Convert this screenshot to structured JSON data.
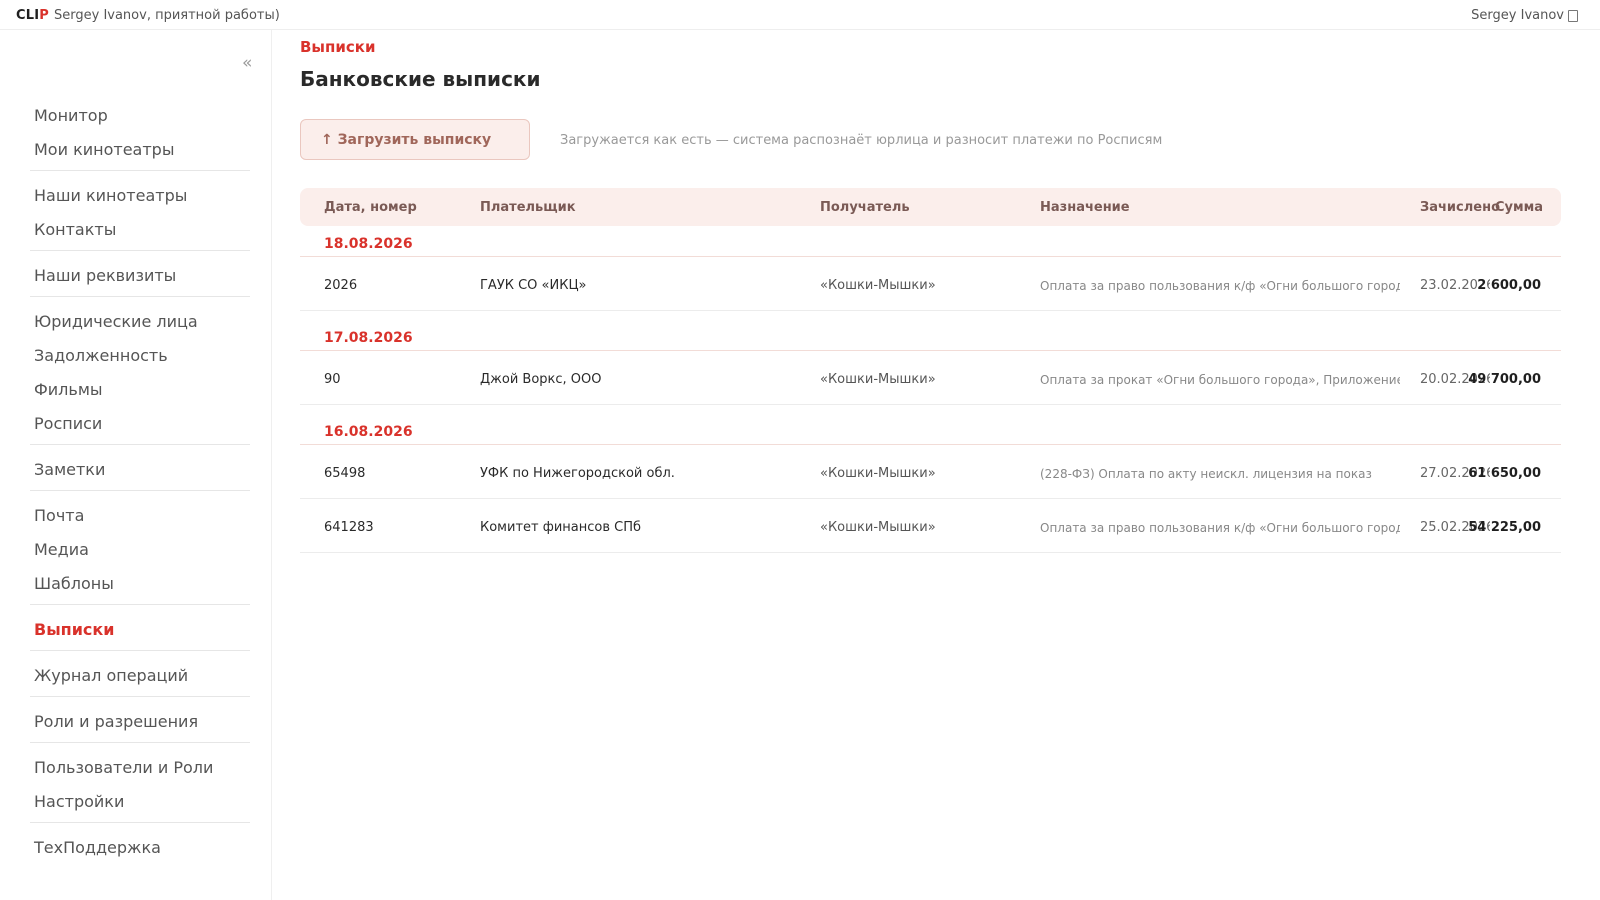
{
  "header": {
    "brand_main": "CLI",
    "brand_accent": "P",
    "greeting": "Sergey Ivanov, приятной работы)",
    "user_name": "Sergey Ivanov"
  },
  "sidebar": {
    "collapse_label": "«",
    "items": [
      {
        "label": "Монитор"
      },
      {
        "label": "Мои кинотеатры"
      },
      {
        "label": "Наши кинотеатры"
      },
      {
        "label": "Контакты"
      },
      {
        "label": "Наши реквизиты"
      },
      {
        "label": "Юридические лица"
      },
      {
        "label": "Задолженность"
      },
      {
        "label": "Фильмы"
      },
      {
        "label": "Росписи"
      },
      {
        "label": "Заметки"
      },
      {
        "label": "Почта"
      },
      {
        "label": "Медиа"
      },
      {
        "label": "Шаблоны"
      },
      {
        "label": "Выписки",
        "active": true
      },
      {
        "label": "Журнал операций"
      },
      {
        "label": "Роли и разрешения"
      },
      {
        "label": "Пользователи и Роли"
      },
      {
        "label": "Настройки"
      },
      {
        "label": "ТехПоддержка"
      }
    ]
  },
  "main": {
    "breadcrumb": "Выписки",
    "title": "Банковские выписки",
    "upload_label": "↑ Загрузить выписку",
    "upload_hint": "Загружается как есть — система распознаёт юрлица и разносит платежи по Росписям",
    "columns": [
      "Дата, номер",
      "Плательщик",
      "Получатель",
      "Назначение",
      "Зачислено",
      "Сумма"
    ],
    "groups": [
      {
        "date": "18.08.2026",
        "rows": [
          {
            "number": "2026",
            "payer": "ГАУК СО «ИКЦ»",
            "recipient": "«Кошки-Мышки»",
            "purpose": "Оплата за право пользования к/ф «Огни большого города»",
            "credited": "23.02.2026",
            "amount": "2 600,00"
          }
        ]
      },
      {
        "date": "17.08.2026",
        "rows": [
          {
            "number": "90",
            "payer": "Джой Воркс, ООО",
            "recipient": "«Кошки-Мышки»",
            "purpose": "Оплата за прокат «Огни большого города», Приложение",
            "credited": "20.02.2026",
            "amount": "49 700,00"
          }
        ]
      },
      {
        "date": "16.08.2026",
        "rows": [
          {
            "number": "65498",
            "payer": "УФК по Нижегородской обл.",
            "recipient": "«Кошки-Мышки»",
            "purpose": "(228-ФЗ) Оплата по акту неискл. лицензия на показ",
            "credited": "27.02.2026",
            "amount": "61 650,00"
          },
          {
            "number": "641283",
            "payer": "Комитет финансов СПб",
            "recipient": "«Кошки-Мышки»",
            "purpose": "Оплата за право пользования к/ф «Огни большого города»",
            "credited": "25.02.2026",
            "amount": "54 225,00"
          }
        ]
      }
    ]
  }
}
